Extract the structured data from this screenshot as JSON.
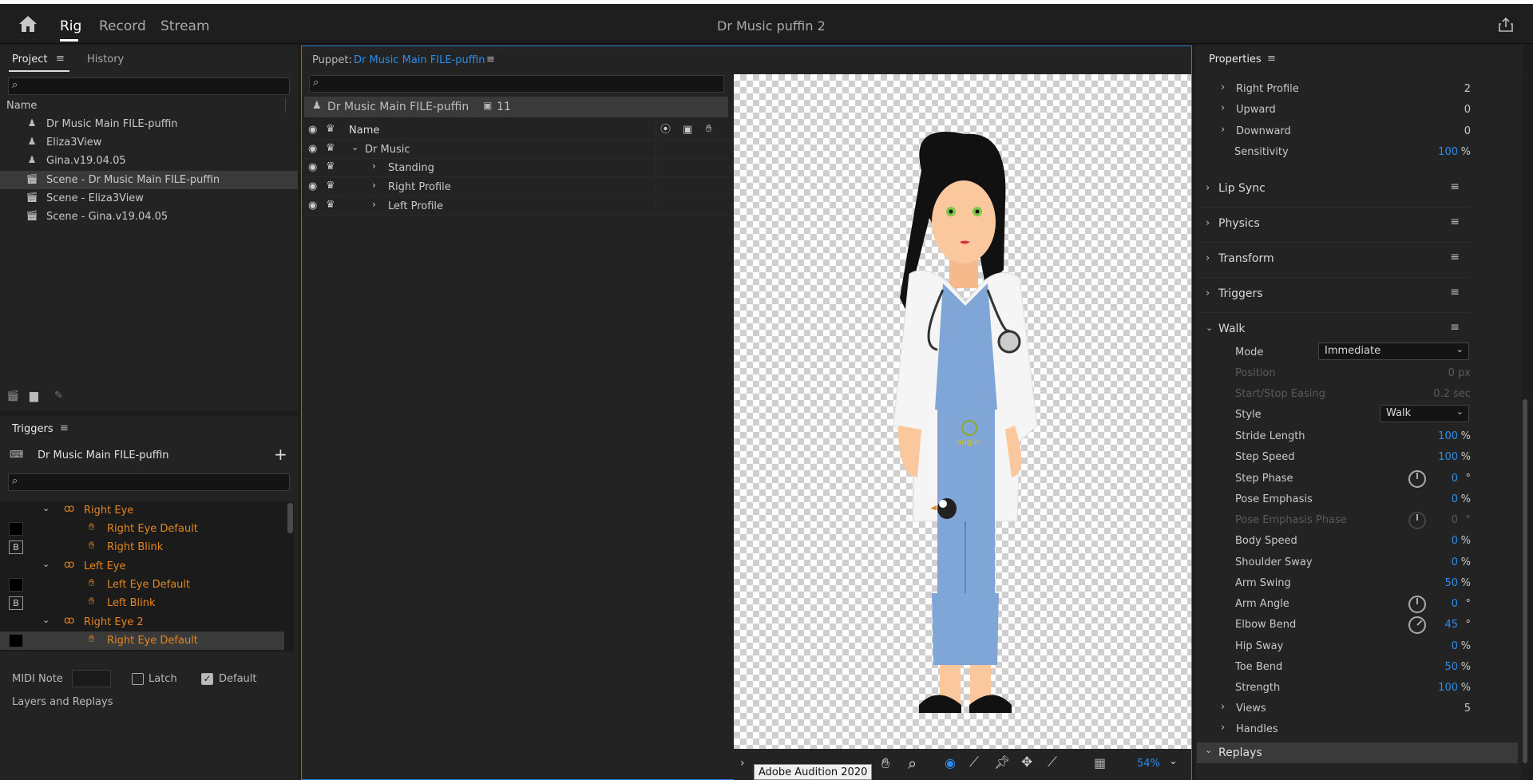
{
  "app": {
    "title": "Dr Music puffin 2",
    "tabs": [
      "Rig",
      "Record",
      "Stream"
    ],
    "active_tab": "Rig"
  },
  "icons": {
    "home": "home-icon",
    "share": "share-icon"
  },
  "project": {
    "tabs": [
      "Project",
      "History"
    ],
    "col_name": "Name",
    "items": [
      {
        "label": "Dr Music Main FILE-puffin",
        "type": "puppet"
      },
      {
        "label": "Eliza3View",
        "type": "puppet"
      },
      {
        "label": "Gina.v19.04.05",
        "type": "puppet"
      },
      {
        "label": "Scene - Dr Music Main FILE-puffin",
        "type": "scene",
        "selected": true
      },
      {
        "label": "Scene - Eliza3View",
        "type": "scene"
      },
      {
        "label": "Scene - Gina.v19.04.05",
        "type": "scene"
      }
    ]
  },
  "triggers": {
    "title": "Triggers",
    "puppet": "Dr Music Main FILE-puffin",
    "rows": [
      {
        "label": "Right Eye",
        "kind": "group"
      },
      {
        "label": "Right Eye Default",
        "kind": "trigger",
        "swatch": true
      },
      {
        "label": "Right Blink",
        "kind": "trigger",
        "key": "B"
      },
      {
        "label": "Left Eye",
        "kind": "group"
      },
      {
        "label": "Left Eye Default",
        "kind": "trigger",
        "swatch": true
      },
      {
        "label": "Left Blink",
        "kind": "trigger",
        "key": "B"
      },
      {
        "label": "Right Eye 2",
        "kind": "group"
      },
      {
        "label": "Right Eye Default",
        "kind": "trigger",
        "swatch": true,
        "selected": true
      }
    ],
    "midi_label": "MIDI Note",
    "latch_label": "Latch",
    "default_label": "Default",
    "latch_checked": false,
    "default_checked": true,
    "layers_label": "Layers and Replays"
  },
  "puppet": {
    "prefix": "Puppet:",
    "name": "Dr Music Main FILE-puffin",
    "root_label": "Dr Music Main FILE-puffin",
    "count": "11",
    "col_name": "Name",
    "layers": [
      {
        "label": "Dr Music",
        "expanded": true,
        "indent": 0
      },
      {
        "label": "Standing",
        "expanded": false,
        "indent": 1
      },
      {
        "label": "Right Profile",
        "expanded": false,
        "indent": 1
      },
      {
        "label": "Left Profile",
        "expanded": false,
        "indent": 1
      }
    ]
  },
  "canvas": {
    "zoom": "54%",
    "origin_label": "origin",
    "tooltip": "Adobe Audition 2020"
  },
  "properties": {
    "title": "Properties",
    "top_rows": [
      {
        "label": "Right Profile",
        "value": "2"
      },
      {
        "label": "Upward",
        "value": "0"
      },
      {
        "label": "Downward",
        "value": "0"
      }
    ],
    "sensitivity": {
      "label": "Sensitivity",
      "value": "100",
      "unit": "%"
    },
    "sections": [
      "Lip Sync",
      "Physics",
      "Transform",
      "Triggers"
    ],
    "walk": {
      "title": "Walk",
      "mode_label": "Mode",
      "mode_value": "Immediate",
      "position_label": "Position",
      "position_value": "0 px",
      "easing_label": "Start/Stop Easing",
      "easing_value": "0.2 sec",
      "style_label": "Style",
      "style_value": "Walk",
      "rows": [
        {
          "label": "Stride Length",
          "value": "100",
          "unit": "%"
        },
        {
          "label": "Step Speed",
          "value": "100",
          "unit": "%"
        },
        {
          "label": "Step Phase",
          "value": "0",
          "unit": "°",
          "dial": true
        },
        {
          "label": "Pose Emphasis",
          "value": "0",
          "unit": "%"
        },
        {
          "label": "Pose Emphasis Phase",
          "value": "0",
          "unit": "°",
          "dial": true,
          "disabled": true
        },
        {
          "label": "Body Speed",
          "value": "0",
          "unit": "%"
        },
        {
          "label": "Shoulder Sway",
          "value": "0",
          "unit": "%"
        },
        {
          "label": "Arm Swing",
          "value": "50",
          "unit": "%"
        },
        {
          "label": "Arm Angle",
          "value": "0",
          "unit": "°",
          "dial": true
        },
        {
          "label": "Elbow Bend",
          "value": "45",
          "unit": "°",
          "dial": true
        },
        {
          "label": "Hip Sway",
          "value": "0",
          "unit": "%"
        },
        {
          "label": "Toe Bend",
          "value": "50",
          "unit": "%"
        },
        {
          "label": "Strength",
          "value": "100",
          "unit": "%"
        }
      ],
      "views_label": "Views",
      "views_value": "5",
      "handles_label": "Handles"
    },
    "replays_label": "Replays"
  },
  "colors": {
    "accent": "#2d8ceb",
    "trigger": "#e5851e",
    "bg": "#1d1d1d"
  }
}
